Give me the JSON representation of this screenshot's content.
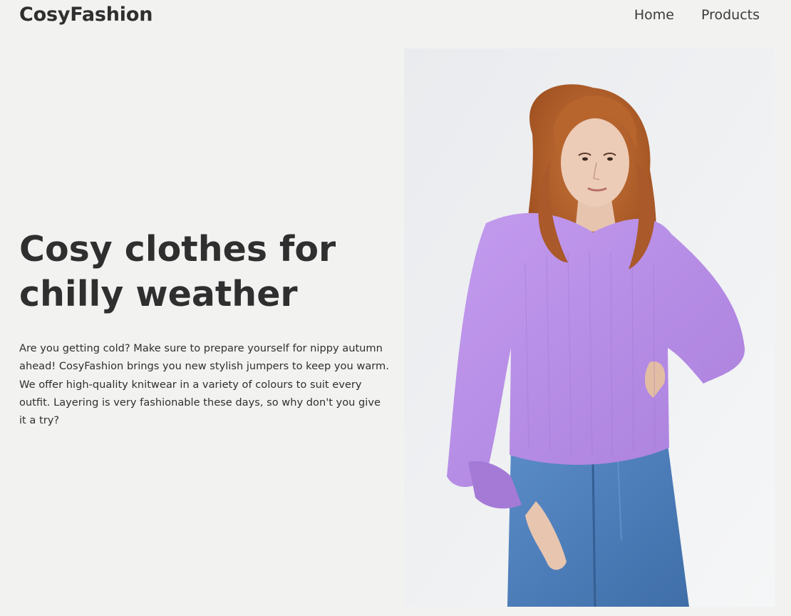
{
  "header": {
    "brand": "CosyFashion",
    "nav": [
      {
        "label": "Home"
      },
      {
        "label": "Products"
      }
    ]
  },
  "hero": {
    "title": "Cosy clothes for chilly weather",
    "text": "Are you getting cold? Make sure to prepare yourself for nippy autumn ahead! CosyFashion brings you new stylish jumpers to keep you warm. We offer high-quality knitwear in a variety of colours to suit every outfit. Layering is very fashionable these days, so why don't you give it a try?"
  },
  "colors": {
    "background": "#f2f3f1",
    "text": "#2f2f2f",
    "sweater": "#b78de6",
    "hair": "#b5602a",
    "jeans": "#4f80bd"
  }
}
